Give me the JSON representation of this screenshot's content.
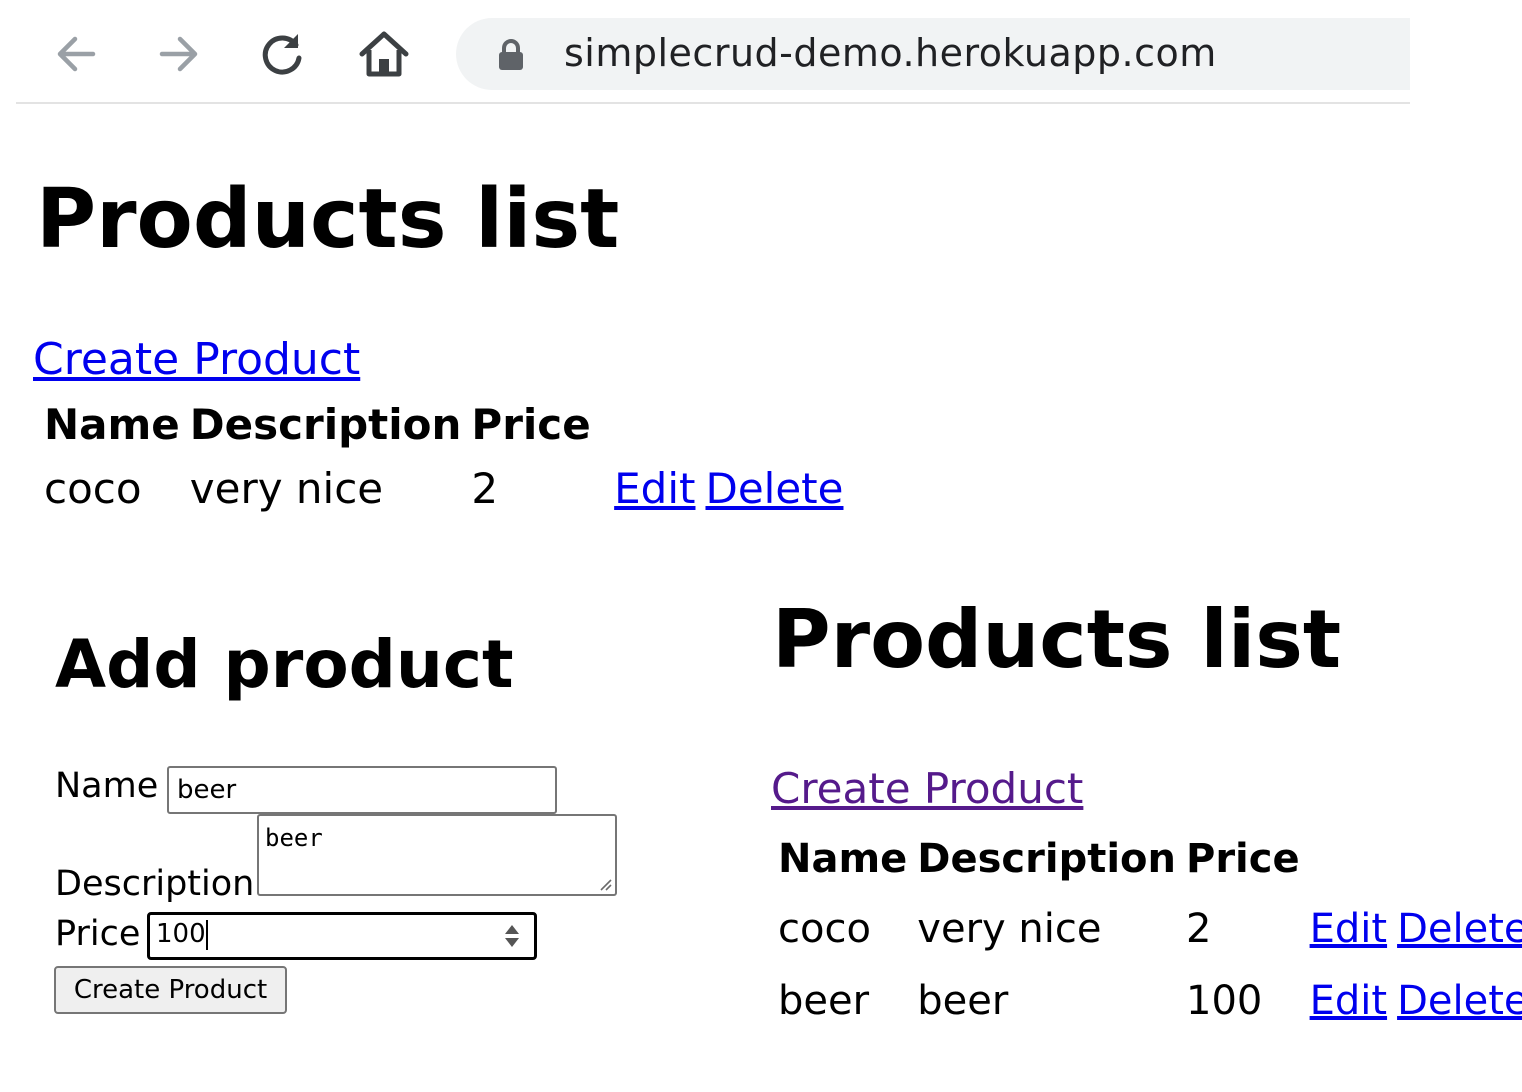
{
  "browser": {
    "url": "simplecrud-demo.herokuapp.com"
  },
  "page1": {
    "title": "Products list",
    "create_link": "Create Product",
    "table": {
      "headers": [
        "Name",
        "Description",
        "Price"
      ],
      "rows": [
        {
          "name": "coco",
          "description": "very nice",
          "price": "2",
          "edit": "Edit",
          "delete": "Delete"
        }
      ]
    }
  },
  "add_form": {
    "title": "Add product",
    "name_label": "Name",
    "name_value": "beer",
    "description_label": "Description",
    "description_value": "beer",
    "price_label": "Price",
    "price_value": "100",
    "submit_label": "Create Product"
  },
  "page2": {
    "title": "Products list",
    "create_link": "Create Product",
    "table": {
      "headers": [
        "Name",
        "Description",
        "Price"
      ],
      "rows": [
        {
          "name": "coco",
          "description": "very nice",
          "price": "2",
          "edit": "Edit",
          "delete": "Delete"
        },
        {
          "name": "beer",
          "description": "beer",
          "price": "100",
          "edit": "Edit",
          "delete": "Delete"
        }
      ]
    }
  },
  "colors": {
    "link": "#0000ee",
    "visited_link": "#551a8b",
    "omnibox_bg": "#f1f3f4"
  },
  "icons": [
    "back-arrow-icon",
    "forward-arrow-icon",
    "reload-icon",
    "home-icon",
    "lock-icon",
    "spinner-arrows-icon",
    "resize-handle-icon"
  ]
}
